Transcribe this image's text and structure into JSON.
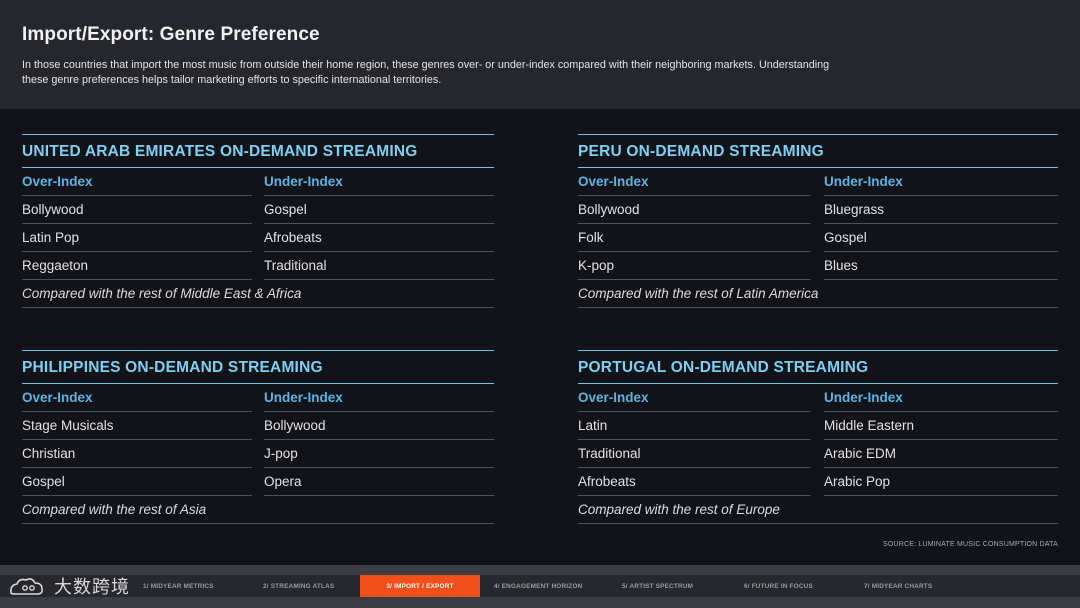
{
  "header": {
    "title": "Import/Export: Genre Preference",
    "description": "In those countries that import the most music from outside their home region, these genres over- or under-index compared with their neighboring markets. Understanding these genre preferences helps tailor marketing efforts to specific international territories."
  },
  "panels": [
    {
      "title": "UNITED ARAB EMIRATES ON-DEMAND STREAMING",
      "over_label": "Over-Index",
      "under_label": "Under-Index",
      "over": [
        "Bollywood",
        "Latin Pop",
        "Reggaeton"
      ],
      "under": [
        "Gospel",
        "Afrobeats",
        "Traditional"
      ],
      "comparison": "Compared with the rest of Middle East & Africa"
    },
    {
      "title": "PERU ON-DEMAND STREAMING",
      "over_label": "Over-Index",
      "under_label": "Under-Index",
      "over": [
        "Bollywood",
        "Folk",
        "K-pop"
      ],
      "under": [
        "Bluegrass",
        "Gospel",
        "Blues"
      ],
      "comparison": "Compared with the rest of Latin America"
    },
    {
      "title": "PHILIPPINES ON-DEMAND STREAMING",
      "over_label": "Over-Index",
      "under_label": "Under-Index",
      "over": [
        "Stage Musicals",
        "Christian",
        "Gospel"
      ],
      "under": [
        "Bollywood",
        "J-pop",
        "Opera"
      ],
      "comparison": "Compared with the rest of Asia"
    },
    {
      "title": "PORTUGAL ON-DEMAND STREAMING",
      "over_label": "Over-Index",
      "under_label": "Under-Index",
      "over": [
        "Latin",
        "Traditional",
        "Afrobeats"
      ],
      "under": [
        "Middle Eastern",
        "Arabic EDM",
        "Arabic Pop"
      ],
      "comparison": "Compared with the rest of Europe"
    }
  ],
  "source": "SOURCE: LUMINATE MUSIC CONSUMPTION DATA",
  "nav": {
    "items": [
      "1/ MIDYEAR METRICS",
      "2/ STREAMING ATLAS",
      "3/ IMPORT / EXPORT",
      "4/ ENGAGEMENT HORIZON",
      "5/ ARTIST SPECTRUM",
      "6/ FUTURE IN FOCUS",
      "7/ MIDYEAR CHARTS"
    ],
    "active_index": 2
  },
  "watermark": {
    "logo_icon": "cloud-logo-icon",
    "text": "大数跨境"
  },
  "colors": {
    "accent_blue": "#7dd0f2",
    "nav_active": "#f04e1a"
  }
}
